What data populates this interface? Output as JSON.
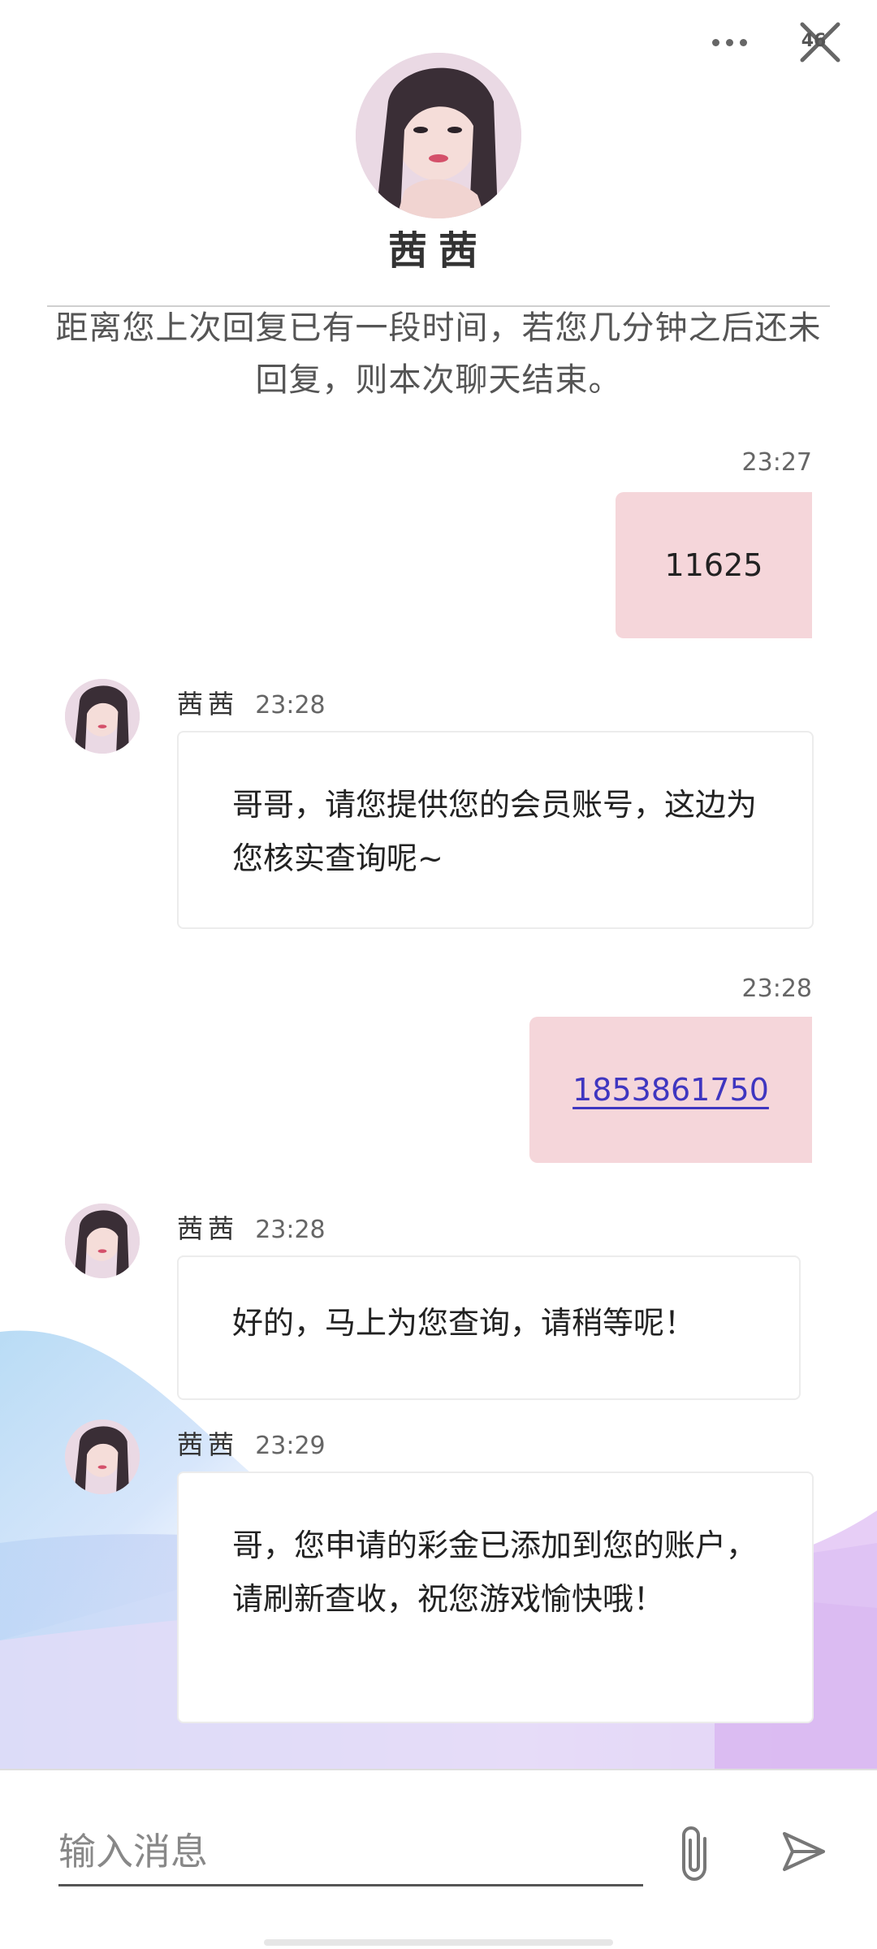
{
  "header": {
    "agent_name": "茜茜",
    "close_badge": "46",
    "notice": "距离您上次回复已有一段时间，若您几分钟之后还未回复，则本次聊天结束。"
  },
  "messages": [
    {
      "direction": "out",
      "time": "23:27",
      "text": "11625"
    },
    {
      "direction": "in",
      "name": "茜茜",
      "time": "23:28",
      "text": "哥哥，请您提供您的会员账号，这边为您核实查询呢~"
    },
    {
      "direction": "out",
      "time": "23:28",
      "text": "1853861750",
      "is_link": true
    },
    {
      "direction": "in",
      "name": "茜茜",
      "time": "23:28",
      "text": "好的，马上为您查询，请稍等呢！"
    },
    {
      "direction": "in",
      "name": "茜茜",
      "time": "23:29",
      "text": "哥，您申请的彩金已添加到您的账户，请刷新查收，祝您游戏愉快哦！"
    }
  ],
  "input": {
    "placeholder": "输入消息"
  },
  "icons": {
    "more": "more-dots-icon",
    "close": "close-icon",
    "attach": "paperclip-icon",
    "send": "send-icon"
  },
  "colors": {
    "outgoing_bubble": "#f5d6da",
    "link": "#3f36c0"
  }
}
